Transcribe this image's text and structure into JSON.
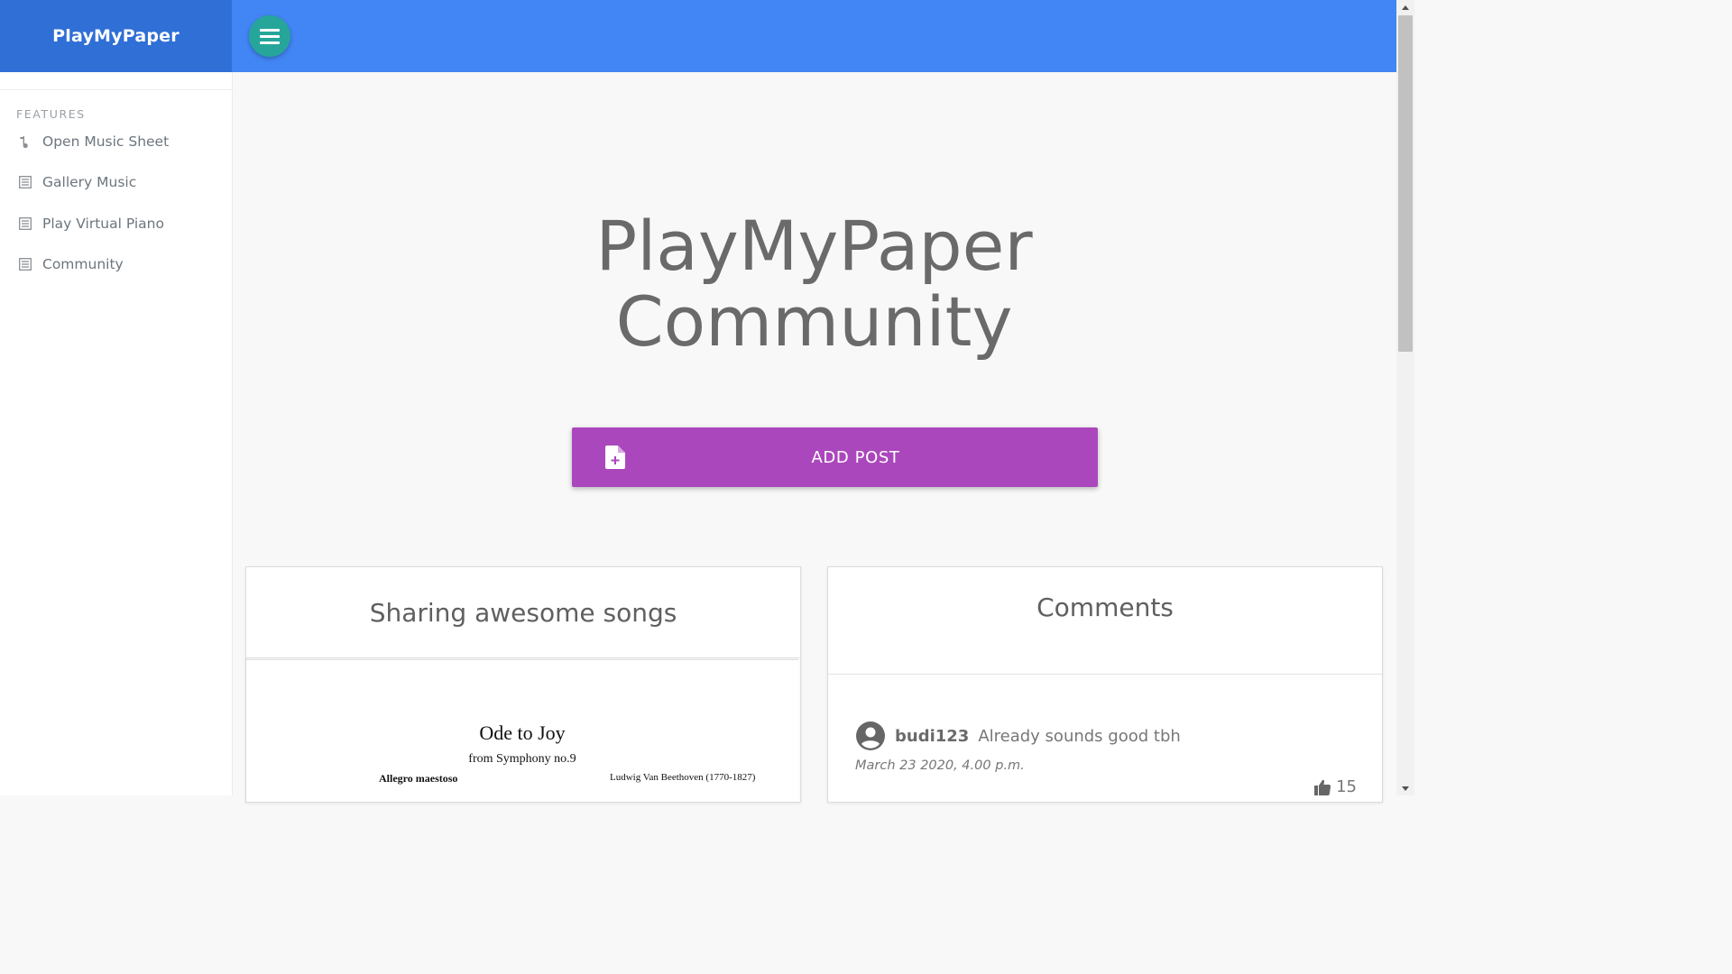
{
  "app": {
    "brand": "PlayMyPaper"
  },
  "sidebar": {
    "section_label": "FEATURES",
    "items": [
      {
        "label": "Open Music Sheet",
        "icon": "music-note-icon"
      },
      {
        "label": "Gallery Music",
        "icon": "list-icon"
      },
      {
        "label": "Play Virtual Piano",
        "icon": "list-icon"
      },
      {
        "label": "Community",
        "icon": "list-icon"
      }
    ]
  },
  "hero": {
    "line1": "PlayMyPaper",
    "line2": "Community"
  },
  "actions": {
    "add_post_label": "ADD POST",
    "add_post_icon": "file-plus-icon"
  },
  "posts_card": {
    "title": "Sharing awesome songs",
    "sheet": {
      "title": "Ode to Joy",
      "subtitle": "from Symphony no.9",
      "tempo": "Allegro maestoso",
      "composer": "Ludwig Van Beethoven (1770-1827)"
    }
  },
  "comments_card": {
    "title": "Comments",
    "comments": [
      {
        "user": "budi123",
        "text": "Already sounds good tbh",
        "date": "March 23 2020, 4.00 p.m.",
        "likes": "15"
      }
    ]
  },
  "colors": {
    "brand_bg": "#2f6fd6",
    "topbar_bg": "#4285f4",
    "menu_button": "#26a69a",
    "add_post": "#ab47bc"
  }
}
